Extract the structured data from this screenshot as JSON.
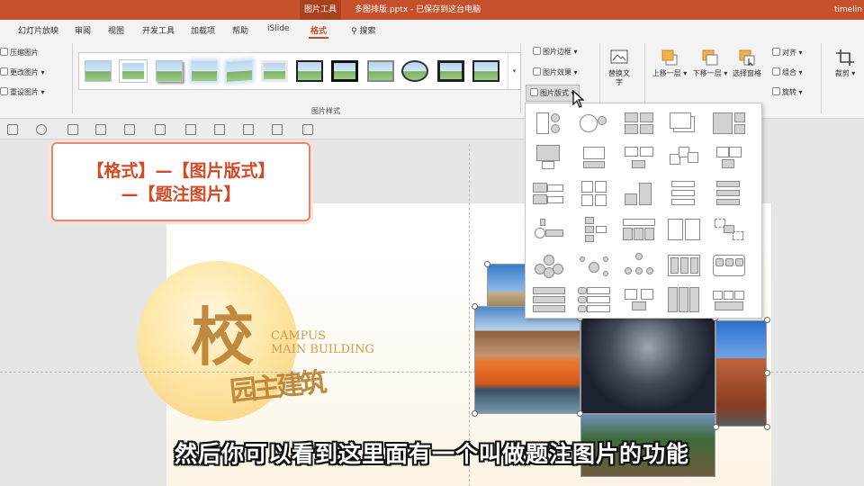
{
  "titlebar": {
    "context_tab": "图片工具",
    "document_title": "多图排版.pptx - 已保存到这台电脑",
    "user": "timelin"
  },
  "tabs": [
    {
      "label": "幻灯片放映"
    },
    {
      "label": "审阅"
    },
    {
      "label": "视图"
    },
    {
      "label": "开发工具"
    },
    {
      "label": "加载项"
    },
    {
      "label": "帮助"
    },
    {
      "label": "iSlide"
    },
    {
      "label": "格式",
      "active": true
    },
    {
      "label": "搜索"
    }
  ],
  "ribbon": {
    "adjust": [
      "压缩图片",
      "更改图片",
      "重设图片"
    ],
    "styles_group_label": "图片样式",
    "right_buttons": [
      "图片边框",
      "图片效果",
      "图片版式"
    ],
    "alt_text": "替换文字",
    "arrange": {
      "bring_forward": "上移一层",
      "send_backward": "下移一层",
      "selection_pane": "选择窗格",
      "align": "对齐",
      "group": "组合",
      "rotate": "旋转"
    },
    "crop": "裁剪"
  },
  "callout": {
    "line1": "【格式】—【图片版式】",
    "line2": "—【题注图片】"
  },
  "slide": {
    "big_char": "校",
    "english_line1": "CAMPUS",
    "english_line2": "MAIN BUILDING",
    "calli_text": "园主建筑"
  },
  "subtitle": "然后你可以看到这里面有一个叫做题注图片的功能",
  "colors": {
    "accent": "#c4512c",
    "callout_text": "#d24a28",
    "callout_border": "#e08a6c"
  }
}
